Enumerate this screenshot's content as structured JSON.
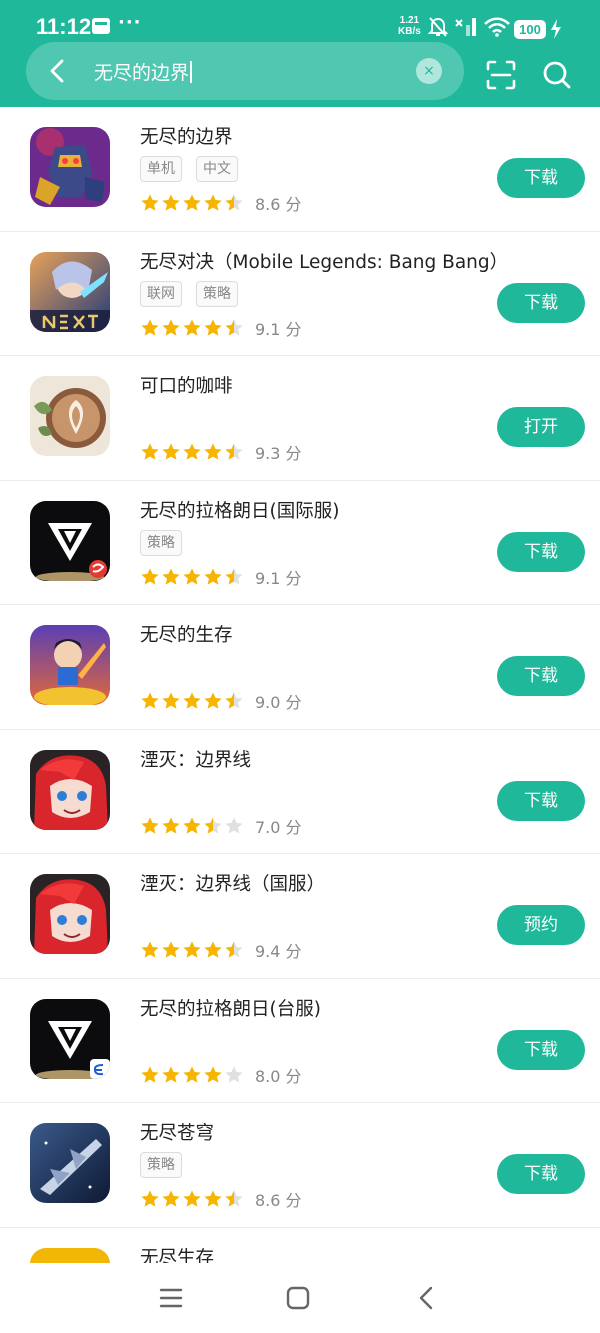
{
  "status_bar": {
    "time": "11:12",
    "more": "···",
    "net_speed_value": "1.21",
    "net_speed_unit": "KB/s",
    "battery": "100"
  },
  "search": {
    "query": "无尽的边界",
    "clear_label": "×"
  },
  "colors": {
    "accent": "#1fb89b",
    "star": "#f7b500",
    "star_empty": "#e0e0e0"
  },
  "apps": [
    {
      "name": "无尽的边界",
      "tags": [
        "单机",
        "中文"
      ],
      "stars": 4.5,
      "score": "8.6 分",
      "action": "下载",
      "icon": "robot-warrior-icon"
    },
    {
      "name": "无尽对决（Mobile Legends: Bang Bang）",
      "tags": [
        "联网",
        "策略"
      ],
      "stars": 4.5,
      "score": "9.1 分",
      "action": "下载",
      "icon": "mobile-legends-next-icon"
    },
    {
      "name": "可口的咖啡",
      "tags": [],
      "stars": 4.5,
      "score": "9.3 分",
      "action": "打开",
      "icon": "coffee-latte-icon"
    },
    {
      "name": "无尽的拉格朗日(国际服)",
      "tags": [
        "策略"
      ],
      "stars": 4.5,
      "score": "9.1 分",
      "action": "下载",
      "icon": "lagrange-logo-icon"
    },
    {
      "name": "无尽的生存",
      "tags": [],
      "stars": 4.5,
      "score": "9.0 分",
      "action": "下载",
      "icon": "survival-hero-icon"
    },
    {
      "name": "湮灭：边界线",
      "tags": [],
      "stars": 3.5,
      "score": "7.0 分",
      "action": "下载",
      "icon": "red-hair-girl-icon"
    },
    {
      "name": "湮灭：边界线（国服）",
      "tags": [],
      "stars": 4.5,
      "score": "9.4 分",
      "action": "预约",
      "icon": "red-hair-girl-icon"
    },
    {
      "name": "无尽的拉格朗日(台服)",
      "tags": [],
      "stars": 4,
      "score": "8.0 分",
      "action": "下载",
      "icon": "lagrange-logo-icon"
    },
    {
      "name": "无尽苍穹",
      "tags": [
        "策略"
      ],
      "stars": 4.5,
      "score": "8.6 分",
      "action": "下载",
      "icon": "spaceship-icon"
    },
    {
      "name": "无尽生存",
      "tags": [],
      "stars": 0,
      "score": "",
      "action": "",
      "icon": "survivor-face-icon"
    }
  ]
}
